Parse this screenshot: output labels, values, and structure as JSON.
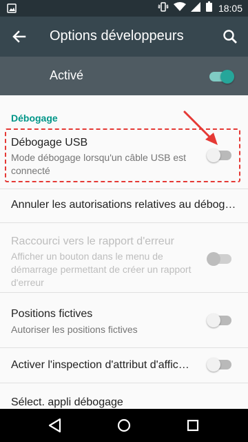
{
  "status_bar": {
    "time": "18:05"
  },
  "app_bar": {
    "title": "Options développeurs"
  },
  "master": {
    "label": "Activé",
    "enabled": true
  },
  "section": {
    "header": "Débogage"
  },
  "rows": [
    {
      "title": "Débogage USB",
      "subtitle": "Mode débogage lorsqu'un câble USB est connecté",
      "switch": "off"
    },
    {
      "title": "Annuler les autorisations relatives au débog…"
    },
    {
      "title": "Raccourci vers le rapport d'erreur",
      "subtitle": "Afficher un bouton dans le menu de démarrage permettant de créer un rapport d'erreur",
      "switch": "disabled"
    },
    {
      "title": "Positions fictives",
      "subtitle": "Autoriser les positions fictives",
      "switch": "off"
    },
    {
      "title": "Activer l'inspection d'attribut d'affic…",
      "switch": "off"
    },
    {
      "title": "Sélect. appli débogage"
    }
  ],
  "colors": {
    "status_bar": "#263238",
    "app_bar": "#37474f",
    "master_bar": "#4f5b62",
    "accent": "#009688",
    "annotation": "#e53935"
  },
  "icons": [
    "image-icon",
    "vibrate-icon",
    "wifi-icon",
    "signal-icon",
    "battery-icon",
    "back-arrow-icon",
    "search-icon",
    "nav-back-icon",
    "nav-home-icon",
    "nav-recents-icon"
  ]
}
